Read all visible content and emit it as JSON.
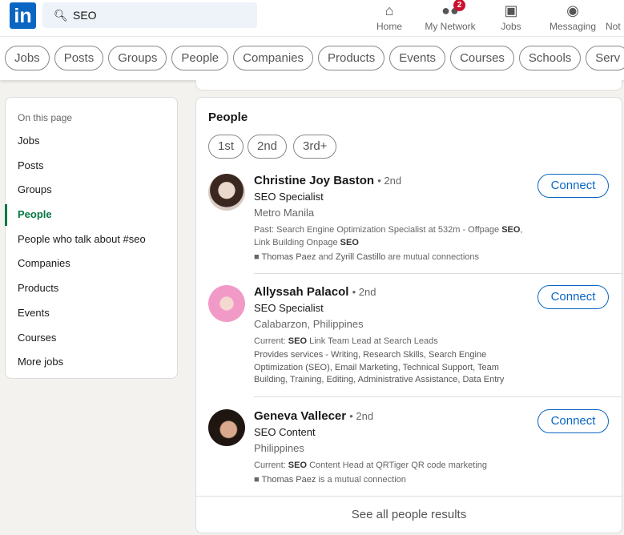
{
  "header": {
    "logo": "in",
    "search_value": "SEO",
    "nav": [
      {
        "label": "Home",
        "icon": "home-icon"
      },
      {
        "label": "My Network",
        "icon": "network-icon",
        "badge": "2"
      },
      {
        "label": "Jobs",
        "icon": "briefcase-icon"
      },
      {
        "label": "Messaging",
        "icon": "chat-icon"
      },
      {
        "label": "Not",
        "icon": "bell-icon"
      }
    ]
  },
  "filters": [
    "Jobs",
    "Posts",
    "Groups",
    "People",
    "Companies",
    "Products",
    "Events",
    "Courses",
    "Schools",
    "Serv"
  ],
  "sidebar": {
    "heading": "On this page",
    "items": [
      "Jobs",
      "Posts",
      "Groups",
      "People",
      "People who talk about #seo",
      "Companies",
      "Products",
      "Events",
      "Courses",
      "More jobs"
    ],
    "active": "People"
  },
  "people": {
    "title": "People",
    "degrees": [
      "1st",
      "2nd",
      "3rd+"
    ],
    "connect_label": "Connect",
    "see_all": "See all people results",
    "results": [
      {
        "name": "Christine Joy Baston",
        "degree": "• 2nd",
        "headline": "SEO Specialist",
        "location": "Metro Manila",
        "snippet_prefix": "Past: Search Engine Optimization Specialist at 532m - Offpage ",
        "snippet_bold1": "SEO",
        "snippet_mid": ", Link Building Onpage ",
        "snippet_bold2": "SEO",
        "mutual_a": "Thomas Paez",
        "mutual_and": " and ",
        "mutual_b": "Zyrill Castillo",
        "mutual_suffix": " are mutual connections"
      },
      {
        "name": "Allyssah Palacol",
        "degree": "• 2nd",
        "headline": "SEO Specialist",
        "location": "Calabarzon, Philippines",
        "snippet_prefix": "Current: ",
        "snippet_bold1": "SEO",
        "snippet_mid": " Link Team Lead at Search Leads",
        "services": "Provides services - Writing, Research Skills, Search Engine Optimization (SEO), Email Marketing, Technical Support, Team Building, Training, Editing, Administrative Assistance, Data Entry"
      },
      {
        "name": "Geneva Vallecer",
        "degree": "• 2nd",
        "headline": "SEO Content",
        "location": "Philippines",
        "snippet_prefix": "Current: ",
        "snippet_bold1": "SEO",
        "snippet_mid": " Content Head at QRTiger QR code marketing",
        "mutual_a": "Thomas Paez",
        "mutual_suffix": " is a mutual connection"
      }
    ]
  }
}
